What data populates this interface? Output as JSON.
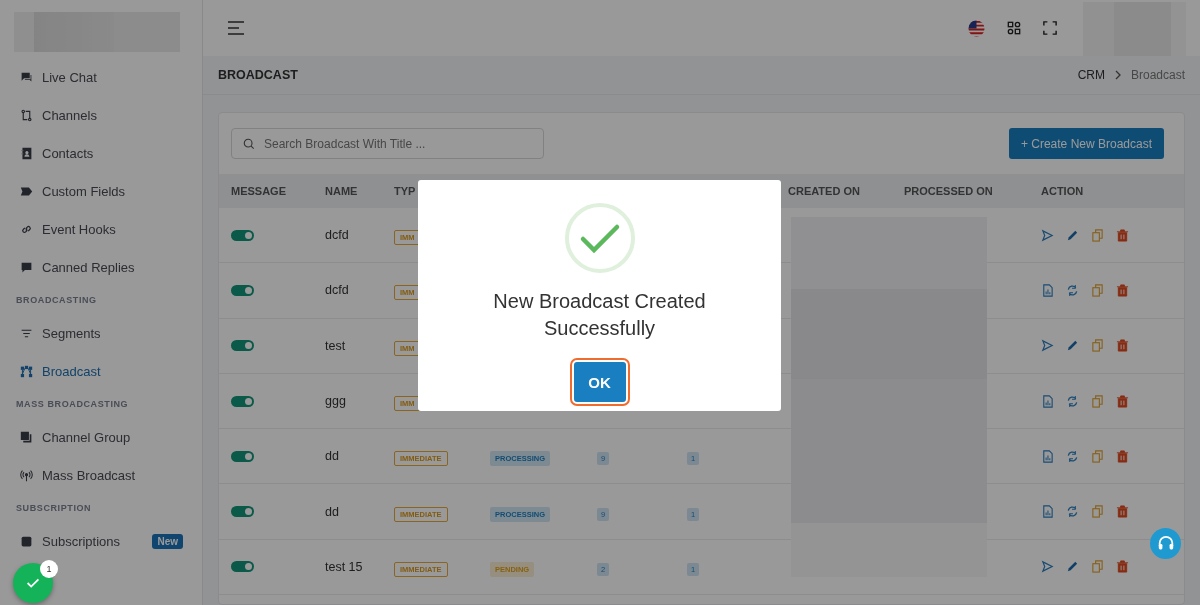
{
  "sidebar": {
    "sections": [
      {
        "items": [
          {
            "label": "Live Chat",
            "selected": false
          },
          {
            "label": "Channels",
            "selected": false
          },
          {
            "label": "Contacts",
            "selected": false
          },
          {
            "label": "Custom Fields",
            "selected": false
          },
          {
            "label": "Event Hooks",
            "selected": false
          },
          {
            "label": "Canned Replies",
            "selected": false
          }
        ]
      },
      {
        "heading": "BROADCASTING",
        "items": [
          {
            "label": "Segments",
            "selected": false
          },
          {
            "label": "Broadcast",
            "selected": true
          }
        ]
      },
      {
        "heading": "MASS BROADCASTING",
        "items": [
          {
            "label": "Channel Group",
            "selected": false
          },
          {
            "label": "Mass Broadcast",
            "selected": false
          }
        ]
      },
      {
        "heading": "SUBSCRIPTION",
        "items": [
          {
            "label": "Subscriptions",
            "selected": false,
            "badge": "New"
          }
        ]
      }
    ]
  },
  "page_title": "BROADCAST",
  "breadcrumb": [
    "CRM",
    "Broadcast"
  ],
  "search": {
    "placeholder": "Search Broadcast With Title ..."
  },
  "create_button": "+ Create New Broadcast",
  "table": {
    "columns": [
      "MESSAGE",
      "NAME",
      "TYP",
      "",
      "",
      "",
      "CREATED ON",
      "PROCESSED ON",
      "ACTION"
    ],
    "rows": [
      {
        "on": true,
        "name": "dcfd",
        "type": "IMM",
        "kind": "send"
      },
      {
        "on": true,
        "name": "dcfd",
        "type": "IMM",
        "kind": "report"
      },
      {
        "on": true,
        "name": "test",
        "type": "IMM",
        "kind": "send"
      },
      {
        "on": true,
        "name": "ggg",
        "type": "IMM",
        "kind": "report"
      },
      {
        "on": true,
        "name": "dd",
        "type": "IMMEDIATE",
        "status": {
          "label": "PROCESSING",
          "kind": "processing"
        },
        "column_5": "9",
        "column_6": "1",
        "kind": "report"
      },
      {
        "on": true,
        "name": "dd",
        "type": "IMMEDIATE",
        "status": {
          "label": "PROCESSING",
          "kind": "processing"
        },
        "column_5": "9",
        "column_6": "1",
        "kind": "report"
      },
      {
        "on": true,
        "name": "test 15",
        "type": "IMMEDIATE",
        "status": {
          "label": "PENDING",
          "kind": "pending"
        },
        "column_5": "2",
        "column_6": "1",
        "kind": "send"
      }
    ]
  },
  "dialog": {
    "title": "New Broadcast Created Successfully",
    "button": "OK"
  },
  "notification_count": "1"
}
